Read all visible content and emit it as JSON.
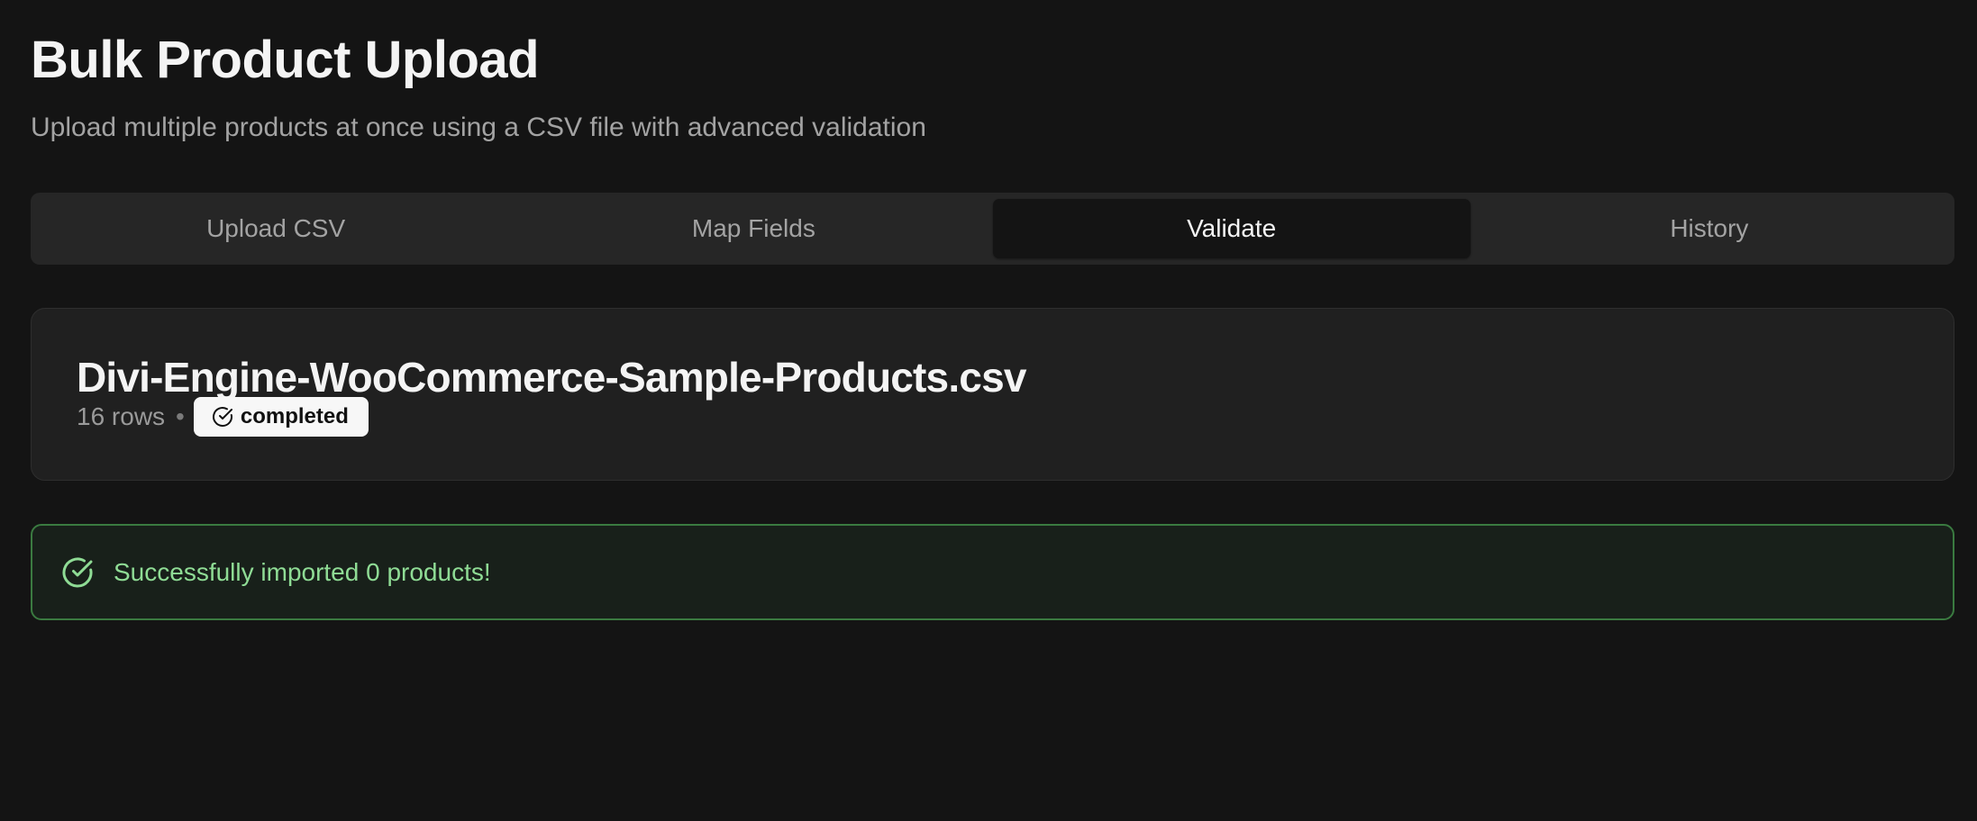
{
  "header": {
    "title": "Bulk Product Upload",
    "subtitle": "Upload multiple products at once using a CSV file with advanced validation"
  },
  "tabs": [
    {
      "label": "Upload CSV",
      "active": false
    },
    {
      "label": "Map Fields",
      "active": false
    },
    {
      "label": "Validate",
      "active": true
    },
    {
      "label": "History",
      "active": false
    }
  ],
  "file": {
    "name": "Divi-Engine-WooCommerce-Sample-Products.csv",
    "rows": "16 rows",
    "separator": "•",
    "status": "completed",
    "status_icon": "check-circle-icon"
  },
  "alert": {
    "icon": "check-circle-icon",
    "message": "Successfully imported 0 products!",
    "color": "#8fdc95",
    "border_color": "#3a7a40"
  }
}
